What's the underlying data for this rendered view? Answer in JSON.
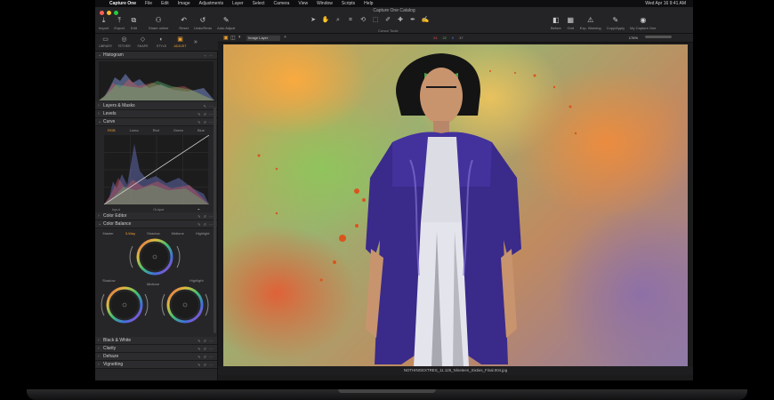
{
  "menubar": {
    "app_name": "Capture One",
    "items": [
      "File",
      "Edit",
      "Image",
      "Adjustments",
      "Layer",
      "Select",
      "Camera",
      "View",
      "Window",
      "Scripts",
      "Help"
    ],
    "clock": "Wed Apr 16  9:41 AM"
  },
  "window": {
    "title": "Capture One Catalog"
  },
  "toolbar": {
    "left": [
      {
        "label": "Import",
        "icon": "import-icon"
      },
      {
        "label": "Export",
        "icon": "export-icon"
      },
      {
        "label": "Edit",
        "icon": "edit-icon"
      },
      {
        "label": "Share online",
        "icon": "share-icon"
      },
      {
        "label": "Reset",
        "icon": "reset-icon"
      },
      {
        "label": "Undo/Redo",
        "icon": "undo-icon"
      },
      {
        "label": "Auto Adjust",
        "icon": "auto-adjust-icon"
      }
    ],
    "tools_caption": "Cursor Tools",
    "right": [
      {
        "label": "Before",
        "icon": "before-icon"
      },
      {
        "label": "Grid",
        "icon": "grid-icon"
      },
      {
        "label": "Exp. Warning",
        "icon": "warning-icon"
      },
      {
        "label": "Copy/Apply",
        "icon": "copy-apply-icon"
      },
      {
        "label": "My Capture One",
        "icon": "user-icon"
      }
    ]
  },
  "tool_tabs": [
    {
      "label": "LIBRARY",
      "icon": "library-icon"
    },
    {
      "label": "TETHER",
      "icon": "tether-icon"
    },
    {
      "label": "SHAPE",
      "icon": "shape-icon"
    },
    {
      "label": "STYLE",
      "icon": "style-icon"
    },
    {
      "label": "ADJUST",
      "icon": "adjust-icon",
      "active": true
    }
  ],
  "panel": {
    "histogram": "Histogram",
    "layers": "Layers & Masks",
    "levels": "Levels",
    "curve": "Curve",
    "curve_tabs": [
      "RGB",
      "Luma",
      "Red",
      "Green",
      "Blue"
    ],
    "input": "Input",
    "output": "Output",
    "color_editor": "Color Editor",
    "color_balance": "Color Balance",
    "cb_tabs": [
      "Master",
      "3-Way",
      "Shadow",
      "Midtone",
      "Highlight"
    ],
    "shadow": "Shadow",
    "midtone": "Midtone",
    "highlight": "Highlight",
    "bw": "Black & White",
    "clarity": "Clarity",
    "dehaze": "Dehaze",
    "vignetting": "Vignetting"
  },
  "viewer": {
    "layer": "Image Layer",
    "counts": [
      "24",
      "22",
      "0",
      "37"
    ],
    "zoom": "176%",
    "filename": "NOTHINGEXTRES_11.125_Nineteen_Sixties_Final.004.jpg"
  },
  "colors": {
    "accent": "#f0a030",
    "jacket": "#3a2a8a"
  }
}
